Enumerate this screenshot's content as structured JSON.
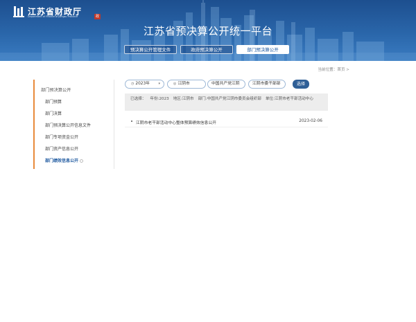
{
  "header": {
    "logo_cn": "江苏省财政厅",
    "logo_en": "Department of Finance of Jiangsu Province",
    "logo_seal": "政",
    "site_title": "江苏省预决算公开统一平台",
    "nav": [
      {
        "label": "预决算公开管理文件",
        "active": false
      },
      {
        "label": "政府预决算公开",
        "active": false
      },
      {
        "label": "部门预决算公开",
        "active": true
      }
    ]
  },
  "breadcrumb": {
    "text": "当前位置：首页 >"
  },
  "sidebar": {
    "heading": "部门预决算公开",
    "items": [
      {
        "label": "部门预算",
        "active": false
      },
      {
        "label": "部门决算",
        "active": false
      },
      {
        "label": "部门预决算公开信息文件",
        "active": false
      },
      {
        "label": "部门专项资金公开",
        "active": false
      },
      {
        "label": "部门资产信息公开",
        "active": false
      },
      {
        "label": "部门绩效信息公开",
        "active": true
      }
    ]
  },
  "filters": {
    "year": "2023年",
    "region": "江阴市",
    "org1": "中国共产党江阴",
    "org2": "江阴市委干部部",
    "select_label": "选择"
  },
  "selected": {
    "prefix": "已选择：",
    "year": "年份:2023",
    "region": "地区:江阴市",
    "dept": "部门:中国共产党江阴市委员会组织部",
    "unit": "单位:江阴市老干部活动中心"
  },
  "results": [
    {
      "title": "江阴市老干部活动中心整体预算绩效信息公开",
      "date": "2023-02-06"
    }
  ],
  "colors": {
    "header_blue": "#2a66aa",
    "accent_orange": "#e8893a",
    "button_blue": "#2f5f96",
    "selected_bar_bg": "#ededed"
  }
}
